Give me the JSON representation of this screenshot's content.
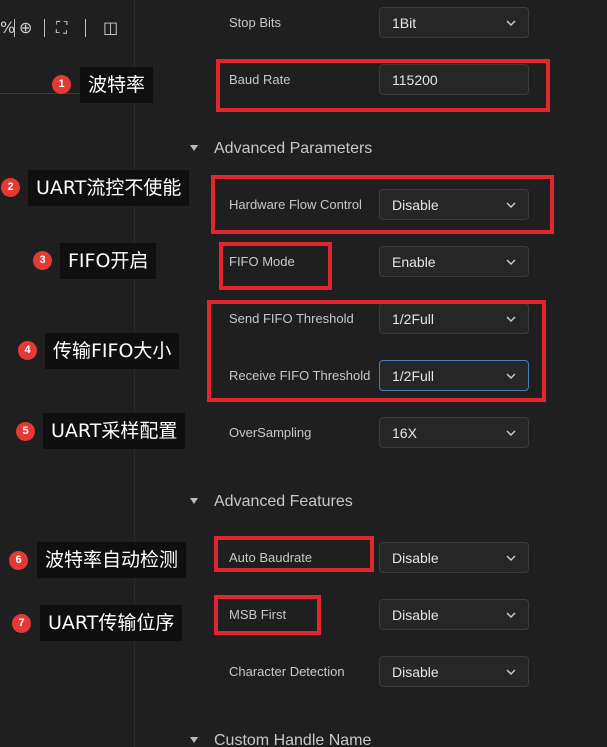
{
  "toolbar": {
    "percent": "%",
    "zoom_in_icon": "⊕",
    "fit_icon": "⛶",
    "panel_icon": "◫"
  },
  "form": {
    "stop_bits": {
      "label": "Stop Bits",
      "value": "1Bit"
    },
    "baud_rate": {
      "label": "Baud Rate",
      "value": "115200"
    },
    "advanced_parameters": {
      "title": "Advanced Parameters"
    },
    "hw_flow": {
      "label": "Hardware Flow Control",
      "value": "Disable"
    },
    "fifo_mode": {
      "label": "FIFO Mode",
      "value": "Enable"
    },
    "send_fifo": {
      "label": "Send FIFO Threshold",
      "value": "1/2Full"
    },
    "recv_fifo": {
      "label": "Receive FIFO Threshold",
      "value": "1/2Full"
    },
    "oversampling": {
      "label": "OverSampling",
      "value": "16X"
    },
    "advanced_features": {
      "title": "Advanced Features"
    },
    "auto_baud": {
      "label": "Auto Baudrate",
      "value": "Disable"
    },
    "msb_first": {
      "label": "MSB First",
      "value": "Disable"
    },
    "char_detect": {
      "label": "Character Detection",
      "value": "Disable"
    },
    "custom_handle": {
      "title": "Custom Handle Name"
    }
  },
  "annotations": [
    {
      "num": "1",
      "text": "波特率"
    },
    {
      "num": "2",
      "text": "UART流控不使能"
    },
    {
      "num": "3",
      "text": "FIFO开启"
    },
    {
      "num": "4",
      "text": "传输FIFO大小"
    },
    {
      "num": "5",
      "text": "UART采样配置"
    },
    {
      "num": "6",
      "text": "波特率自动检测"
    },
    {
      "num": "7",
      "text": "UART传输位序"
    }
  ],
  "colors": {
    "background": "#1f1f1f",
    "highlight": "#e0262f",
    "badge": "#e53935",
    "focus": "#4a7db8"
  }
}
